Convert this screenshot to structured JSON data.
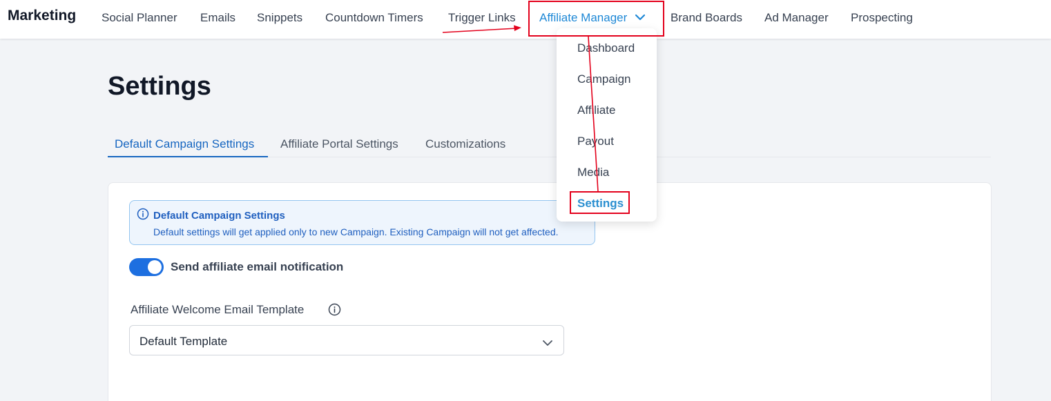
{
  "app": {
    "title": "Marketing"
  },
  "nav": {
    "items": [
      "Social Planner",
      "Emails",
      "Snippets",
      "Countdown Timers",
      "Trigger Links",
      "Affiliate Manager",
      "Brand Boards",
      "Ad Manager",
      "Prospecting"
    ],
    "active": "Affiliate Manager"
  },
  "dropdown": {
    "items": [
      "Dashboard",
      "Campaign",
      "Affiliate",
      "Payout",
      "Media",
      "Settings"
    ],
    "selected": "Settings"
  },
  "page": {
    "title": "Settings"
  },
  "tabs": {
    "items": [
      "Default Campaign Settings",
      "Affiliate Portal Settings",
      "Customizations"
    ],
    "active": "Default Campaign Settings"
  },
  "info": {
    "title": "Default Campaign Settings",
    "description": "Default settings will get applied only to new Campaign. Existing Campaign will not get affected."
  },
  "toggle": {
    "label": "Send affiliate email notification",
    "on": true
  },
  "field": {
    "label": "Affiliate Welcome Email Template",
    "value": "Default Template"
  },
  "icons": {
    "dropdown_caret": "chevron-down-icon",
    "info": "info-icon",
    "select_caret": "chevron-down-icon"
  },
  "colors": {
    "accent": "#1e88d6",
    "tab_active": "#1565c0",
    "toggle_on": "#1d6fe0",
    "annotation": "#e3001b",
    "info_bg": "#eef5fd"
  }
}
